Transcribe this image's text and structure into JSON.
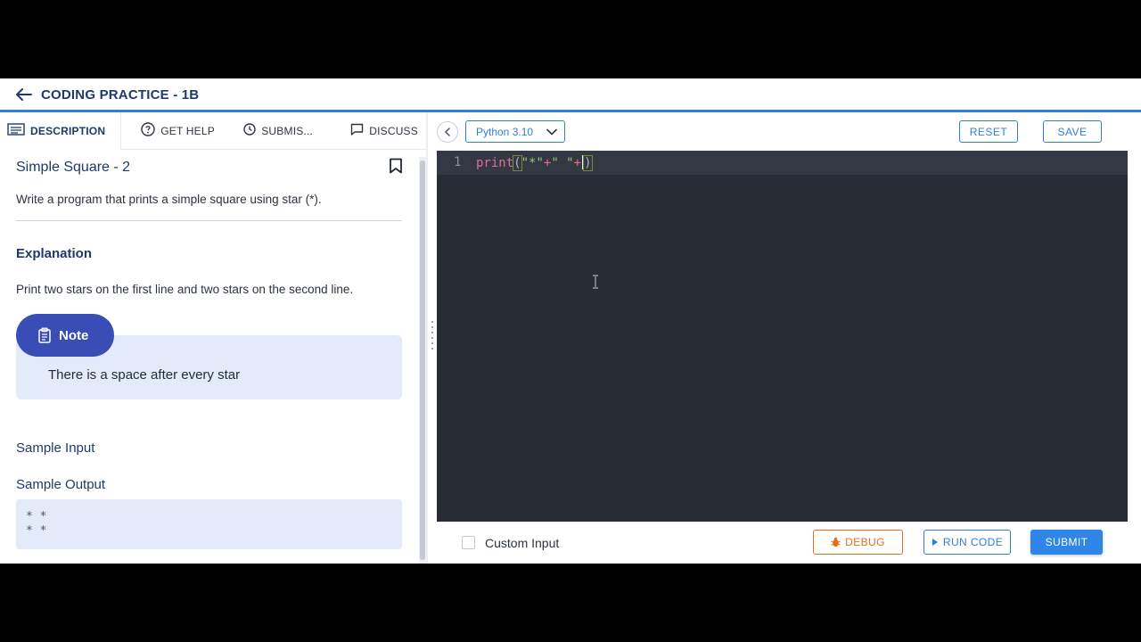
{
  "header": {
    "title": "CODING PRACTICE - 1B"
  },
  "tabs": [
    {
      "label": "DESCRIPTION",
      "icon": "description-icon"
    },
    {
      "label": "GET HELP",
      "icon": "help-circle-icon"
    },
    {
      "label": "SUBMIS...",
      "icon": "clock-icon"
    },
    {
      "label": "DISCUSS",
      "icon": "chat-icon"
    }
  ],
  "problem": {
    "title": "Simple Square - 2",
    "text": "Write a program that prints a simple square using star (*).",
    "explanation_heading": "Explanation",
    "explanation_text": "Print two stars on the first line and two stars on the second line.",
    "note_label": "Note",
    "note_text": "There is a space after every star",
    "sample_input_heading": "Sample Input",
    "sample_output_heading": "Sample Output",
    "sample_output_lines": [
      "* *",
      "* *"
    ]
  },
  "editor": {
    "language": "Python 3.10",
    "reset_label": "RESET",
    "save_label": "SAVE",
    "line_number": "1",
    "code": {
      "fn": "print",
      "open": "(",
      "s1": "\"*\"",
      "plus1": "+",
      "s2": "\" \"",
      "plus2": "+",
      "close": ")"
    }
  },
  "footer": {
    "custom_input_label": "Custom Input",
    "debug_label": "DEBUG",
    "run_label": "RUN CODE",
    "submit_label": "SUBMIT"
  },
  "colors": {
    "accent": "#2f7fd6",
    "debug": "#e0701b",
    "note_pill": "#3a4db6",
    "editor_bg": "#282c34"
  }
}
